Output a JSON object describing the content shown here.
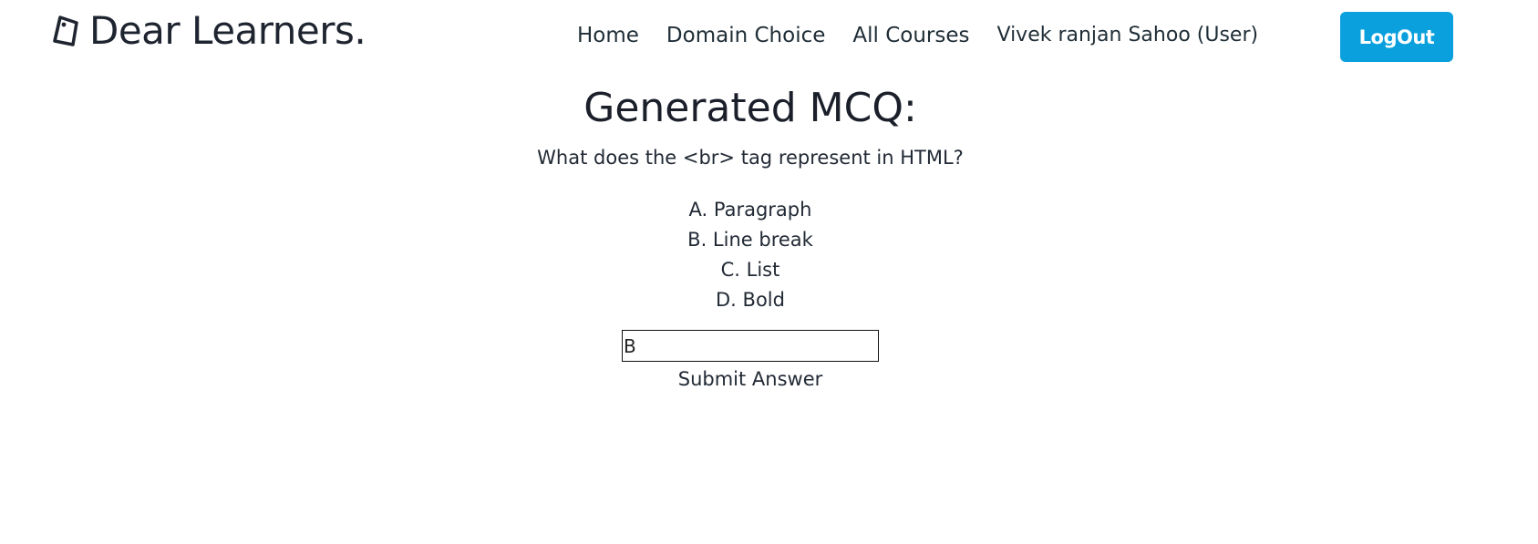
{
  "header": {
    "brand": "Dear Learners.",
    "brand_icon": "tag-icon",
    "nav": {
      "home": "Home",
      "domain_choice": "Domain Choice",
      "all_courses": "All Courses"
    },
    "user": "Vivek ranjan Sahoo (User)",
    "logout": "LogOut",
    "accent_color": "#0aa0dd"
  },
  "main": {
    "title": "Generated MCQ:",
    "question": "What does the <br> tag represent in HTML?",
    "options": [
      "A. Paragraph",
      "B. Line break",
      "C. List",
      "D. Bold"
    ],
    "answer_value": "B",
    "submit_label": "Submit Answer"
  }
}
